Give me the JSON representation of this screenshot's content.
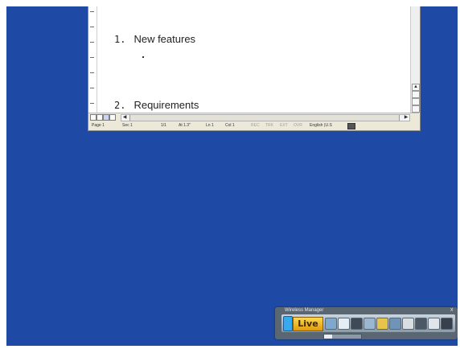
{
  "document": {
    "headings": [
      {
        "number": "1.",
        "text": "New features"
      },
      {
        "number": "2.",
        "text": "Requirements"
      }
    ]
  },
  "status_bar": {
    "page": "Page 1",
    "section": "Sec 1",
    "page_of": "1/1",
    "at": "At 1.3\"",
    "line": "Ln 1",
    "column": "Col 1",
    "rec": "REC",
    "trk": "TRK",
    "ext": "EXT",
    "ovr": "OVR",
    "language": "English (U.S"
  },
  "wireless_manager": {
    "title": "Wireless Manager",
    "live_label": "Live",
    "close_glyph": "x"
  },
  "icons": {
    "scroll_up": "▲",
    "scroll_down": "▼",
    "scroll_left": "◀",
    "scroll_right": "▶"
  },
  "colors": {
    "desktop": "#1e4aa5",
    "word_chrome": "#ece9d8",
    "live_badge": "#f2b21f"
  }
}
